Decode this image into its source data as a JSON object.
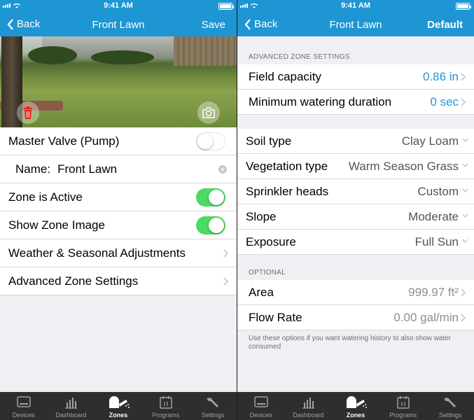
{
  "status": {
    "time": "9:41 AM"
  },
  "left": {
    "nav": {
      "back": "Back",
      "title": "Front Lawn",
      "action": "Save"
    },
    "rows": {
      "master_valve": "Master Valve (Pump)",
      "name_label": "Name:",
      "name_value": "Front Lawn",
      "zone_active": "Zone is Active",
      "show_image": "Show Zone Image",
      "weather": "Weather & Seasonal Adjustments",
      "advanced": "Advanced Zone Settings"
    },
    "toggles": {
      "master_valve": false,
      "zone_active": true,
      "show_image": true
    }
  },
  "right": {
    "nav": {
      "back": "Back",
      "title": "Front Lawn",
      "action": "Default"
    },
    "advanced_header": "ADVANCED ZONE SETTINGS",
    "field_capacity": {
      "label": "Field capacity",
      "value": "0.86 in"
    },
    "min_duration": {
      "label": "Minimum watering duration",
      "value": "0 sec"
    },
    "soil": {
      "label": "Soil type",
      "value": "Clay Loam"
    },
    "vegetation": {
      "label": "Vegetation type",
      "value": "Warm Season Grass"
    },
    "sprinkler": {
      "label": "Sprinkler heads",
      "value": "Custom"
    },
    "slope": {
      "label": "Slope",
      "value": "Moderate"
    },
    "exposure": {
      "label": "Exposure",
      "value": "Full Sun"
    },
    "optional_header": "OPTIONAL",
    "area": {
      "label": "Area",
      "value": "999.97 ft²"
    },
    "flow": {
      "label": "Flow Rate",
      "value": "0.00 gal/min"
    },
    "note": "Use these options if you want watering history to also show water consumed"
  },
  "tabs": [
    {
      "label": "Devices",
      "icon": "device-icon"
    },
    {
      "label": "Dashboard",
      "icon": "bar-chart-icon"
    },
    {
      "label": "Zones",
      "icon": "watering-can-icon",
      "active": true
    },
    {
      "label": "Programs",
      "icon": "calendar-icon"
    },
    {
      "label": "Settings",
      "icon": "wrench-icon"
    }
  ],
  "colors": {
    "accent": "#1e96d3",
    "toggle_on": "#4cd964",
    "trash": "#e0221c"
  }
}
